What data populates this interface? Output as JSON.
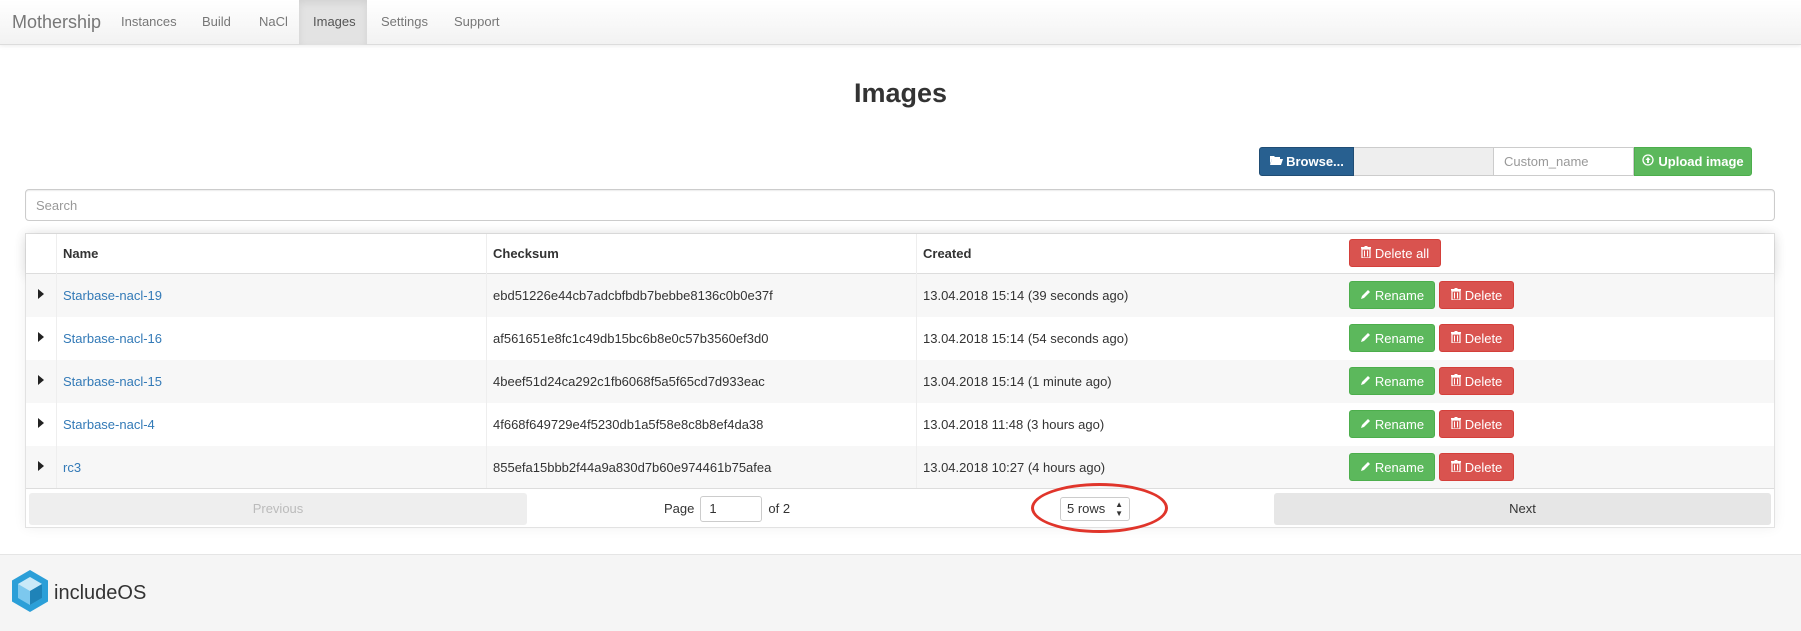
{
  "navbar": {
    "brand": "Mothership",
    "items": [
      {
        "label": "Instances"
      },
      {
        "label": "Build"
      },
      {
        "label": "NaCl"
      },
      {
        "label": "Images",
        "active": true
      },
      {
        "label": "Settings"
      },
      {
        "label": "Support"
      }
    ]
  },
  "page": {
    "title": "Images"
  },
  "upload": {
    "browse_label": "Browse...",
    "browse_icon": "folder-open-icon",
    "file_value": "",
    "custom_name_placeholder": "Custom_name",
    "upload_label": "Upload image",
    "upload_icon": "upload-circle-icon"
  },
  "search": {
    "placeholder": "Search"
  },
  "table": {
    "columns": {
      "name": "Name",
      "checksum": "Checksum",
      "created": "Created"
    },
    "delete_all_label": "Delete all",
    "rename_label": "Rename",
    "delete_label": "Delete",
    "rows": [
      {
        "name": "Starbase-nacl-19",
        "checksum": "ebd51226e44cb7adcbfbdb7bebbe8136c0b0e37f",
        "created": "13.04.2018 15:14 (39 seconds ago)"
      },
      {
        "name": "Starbase-nacl-16",
        "checksum": "af561651e8fc1c49db15bc6b8e0c57b3560ef3d0",
        "created": "13.04.2018 15:14 (54 seconds ago)"
      },
      {
        "name": "Starbase-nacl-15",
        "checksum": "4beef51d24ca292c1fb6068f5a5f65cd7d933eac",
        "created": "13.04.2018 15:14 (1 minute ago)"
      },
      {
        "name": "Starbase-nacl-4",
        "checksum": "4f668f649729e4f5230db1a5f58e8c8b8ef4da38",
        "created": "13.04.2018 11:48 (3 hours ago)"
      },
      {
        "name": "rc3",
        "checksum": "855efa15bbb2f44a9a830d7b60e974461b75afea",
        "created": "13.04.2018 10:27 (4 hours ago)"
      }
    ]
  },
  "pagination": {
    "previous_label": "Previous",
    "next_label": "Next",
    "page_label": "Page",
    "page_value": "1",
    "of_label": "of 2",
    "rows_value": "5 rows"
  },
  "footer": {
    "logo_text_a": "include",
    "logo_text_b": "OS"
  },
  "colors": {
    "primary": "#286090",
    "success": "#5cb85c",
    "danger": "#d9534f",
    "link": "#337ab7",
    "highlight": "#e0352b"
  }
}
